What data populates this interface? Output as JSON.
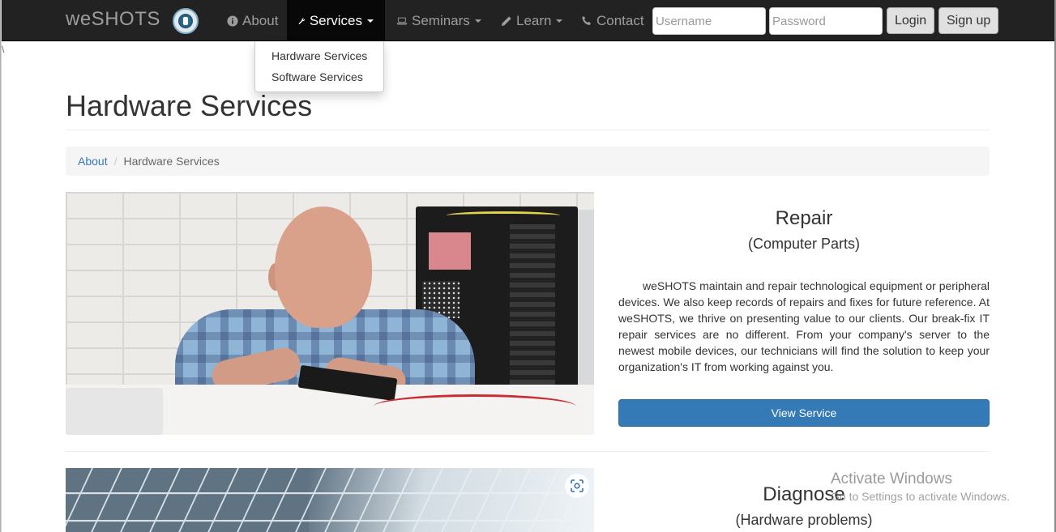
{
  "navbar": {
    "brand": "weSHOTS",
    "items": [
      {
        "label": "About",
        "icon": "info-circle-icon"
      },
      {
        "label": "Services",
        "icon": "wrench-icon",
        "active": true
      },
      {
        "label": "Seminars",
        "icon": "laptop-icon"
      },
      {
        "label": "Learn",
        "icon": "pencil-icon"
      },
      {
        "label": "Contact",
        "icon": "phone-icon"
      }
    ],
    "username_placeholder": "Username",
    "password_placeholder": "Password",
    "login_label": "Login",
    "signup_label": "Sign up"
  },
  "services_dropdown": [
    "Hardware Services",
    "Software Services"
  ],
  "stray_mark": "\\",
  "page": {
    "title": "Hardware Services",
    "breadcrumb": {
      "parent": "About",
      "separator": "/",
      "current": "Hardware Services"
    }
  },
  "services": [
    {
      "title": "Repair",
      "subtitle": "(Computer Parts)",
      "description": "weSHOTS maintain and repair technological equipment or peripheral devices. We also keep records of repairs and fixes for future reference. At weSHOTS, we thrive on presenting value to our clients. Our break-fix IT repair services are no different. From your company's server to the newest mobile devices, our technicians will find the solution to keep your organization's IT from working against you.",
      "button_label": "View Service"
    },
    {
      "title": "Diagnose",
      "subtitle": "(Hardware problems)"
    }
  ],
  "watermark": {
    "title": "Activate Windows",
    "subtitle": "Go to Settings to activate Windows."
  },
  "colors": {
    "navbar_bg": "#222222",
    "primary_button": "#337ab7",
    "link": "#337ab7"
  }
}
